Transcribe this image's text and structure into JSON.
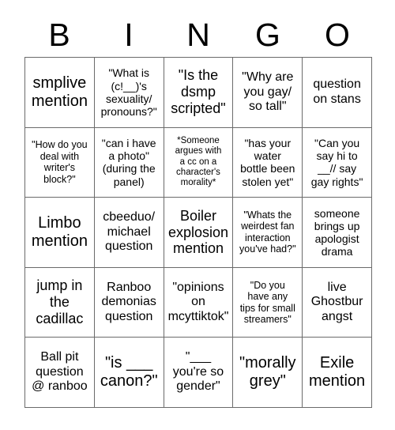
{
  "card": {
    "title_letters": [
      "B",
      "I",
      "N",
      "G",
      "O"
    ],
    "columns": 5,
    "rows": 5,
    "grid_line_color": "#6b6b6b",
    "background_color": "#ffffff",
    "text_color": "#000000"
  },
  "cells": [
    {
      "row": 1,
      "col": 1,
      "text": "smplive\nmention",
      "size": "fs-xl"
    },
    {
      "row": 1,
      "col": 2,
      "text": "\"What is\n(c!__)'s\nsexuality/\npronouns?\"",
      "size": "fs-sm"
    },
    {
      "row": 1,
      "col": 3,
      "text": "\"Is the\ndsmp\nscripted\"",
      "size": "fs-lg"
    },
    {
      "row": 1,
      "col": 4,
      "text": "\"Why are\nyou gay/\nso tall\"",
      "size": "fs-md"
    },
    {
      "row": 1,
      "col": 5,
      "text": "question\non stans",
      "size": "fs-md"
    },
    {
      "row": 2,
      "col": 1,
      "text": "\"How do you\ndeal with\nwriter's\nblock?\"",
      "size": "fs-xs"
    },
    {
      "row": 2,
      "col": 2,
      "text": "\"can i have\na photo\"\n(during the\npanel)",
      "size": "fs-sm"
    },
    {
      "row": 2,
      "col": 3,
      "text": "*Someone\nargues with\na cc on a\ncharacter's\nmorality*",
      "size": "fs-xxs"
    },
    {
      "row": 2,
      "col": 4,
      "text": "\"has your\nwater\nbottle been\nstolen yet\"",
      "size": "fs-sm"
    },
    {
      "row": 2,
      "col": 5,
      "text": "\"Can you\nsay hi to\n__// say\ngay rights\"",
      "size": "fs-sm"
    },
    {
      "row": 3,
      "col": 1,
      "text": "Limbo\nmention",
      "size": "fs-xl"
    },
    {
      "row": 3,
      "col": 2,
      "text": "cbeeduo/\nmichael\nquestion",
      "size": "fs-md"
    },
    {
      "row": 3,
      "col": 3,
      "text": "Boiler\nexplosion\nmention",
      "size": "fs-lg"
    },
    {
      "row": 3,
      "col": 4,
      "text": "\"Whats the\nweirdest fan\ninteraction\nyou've had?\"",
      "size": "fs-xs"
    },
    {
      "row": 3,
      "col": 5,
      "text": "someone\nbrings up\napologist\ndrama",
      "size": "fs-sm"
    },
    {
      "row": 4,
      "col": 1,
      "text": "jump in\nthe\ncadillac",
      "size": "fs-lg"
    },
    {
      "row": 4,
      "col": 2,
      "text": "Ranboo\ndemonias\nquestion",
      "size": "fs-md"
    },
    {
      "row": 4,
      "col": 3,
      "text": "\"opinions\non\nmcyttiktok\"",
      "size": "fs-md"
    },
    {
      "row": 4,
      "col": 4,
      "text": "\"Do you\nhave any\ntips for small\nstreamers\"",
      "size": "fs-xs"
    },
    {
      "row": 4,
      "col": 5,
      "text": "live\nGhostbur\nangst",
      "size": "fs-md"
    },
    {
      "row": 5,
      "col": 1,
      "text": "Ball pit\nquestion\n@ ranboo",
      "size": "fs-md"
    },
    {
      "row": 5,
      "col": 2,
      "text": "\"is ___\ncanon?\"",
      "size": "fs-xl"
    },
    {
      "row": 5,
      "col": 3,
      "text": "\"___\nyou're so\ngender\"",
      "size": "fs-md"
    },
    {
      "row": 5,
      "col": 4,
      "text": "\"morally\ngrey\"",
      "size": "fs-xl"
    },
    {
      "row": 5,
      "col": 5,
      "text": "Exile\nmention",
      "size": "fs-xl"
    }
  ]
}
